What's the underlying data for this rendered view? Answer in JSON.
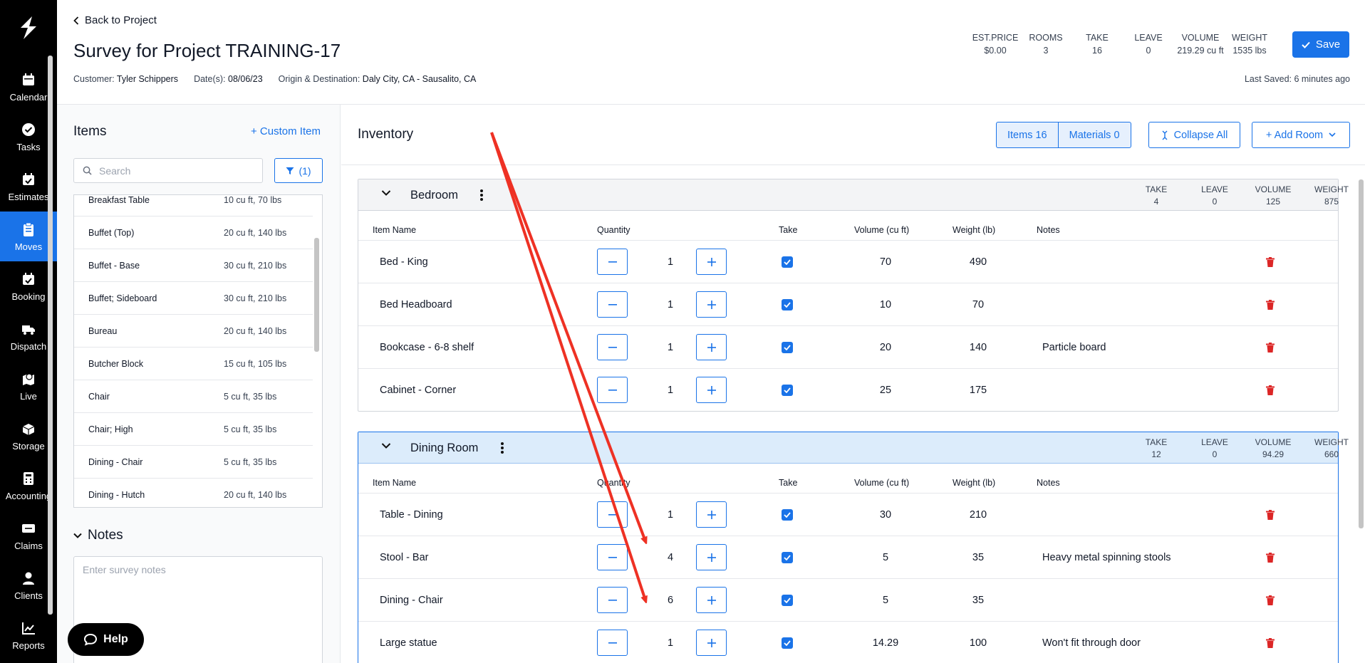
{
  "nav": {
    "items": [
      {
        "label": "Calendar",
        "icon": "calendar-icon"
      },
      {
        "label": "Tasks",
        "icon": "check-circle-icon"
      },
      {
        "label": "Estimates",
        "icon": "calendar-check-icon"
      },
      {
        "label": "Moves",
        "icon": "clipboard-icon",
        "active": true
      },
      {
        "label": "Booking",
        "icon": "calendar-check-icon"
      },
      {
        "label": "Dispatch",
        "icon": "truck-icon"
      },
      {
        "label": "Live",
        "icon": "map-pin-icon"
      },
      {
        "label": "Storage",
        "icon": "box-icon"
      },
      {
        "label": "Accounting",
        "icon": "calculator-icon"
      },
      {
        "label": "Claims",
        "icon": "ticket-icon"
      },
      {
        "label": "Clients",
        "icon": "user-icon"
      },
      {
        "label": "Reports",
        "icon": "chart-icon"
      }
    ]
  },
  "header": {
    "back_label": "Back to Project",
    "title": "Survey for Project TRAINING-17",
    "customer_label": "Customer:",
    "customer": "Tyler Schippers",
    "dates_label": "Date(s):",
    "dates": "08/06/23",
    "route_label": "Origin & Destination:",
    "route": "Daly City, CA - Sausalito, CA",
    "stats": [
      {
        "label": "EST.PRICE",
        "value": "$0.00"
      },
      {
        "label": "ROOMS",
        "value": "3"
      },
      {
        "label": "TAKE",
        "value": "16"
      },
      {
        "label": "LEAVE",
        "value": "0"
      },
      {
        "label": "VOLUME",
        "value": "219.29 cu ft"
      },
      {
        "label": "WEIGHT",
        "value": "1535 lbs"
      }
    ],
    "save_label": "Save",
    "last_saved": "Last Saved: 6 minutes ago"
  },
  "items_panel": {
    "title": "Items",
    "custom_item_label": "+ Custom Item",
    "search_placeholder": "Search",
    "filter_label": "(1)",
    "list": [
      {
        "name": "Breakfast Table",
        "size": "10 cu ft, 70 lbs"
      },
      {
        "name": "Buffet (Top)",
        "size": "20 cu ft, 140 lbs"
      },
      {
        "name": "Buffet - Base",
        "size": "30 cu ft, 210 lbs"
      },
      {
        "name": "Buffet; Sideboard",
        "size": "30 cu ft, 210 lbs"
      },
      {
        "name": "Bureau",
        "size": "20 cu ft, 140 lbs"
      },
      {
        "name": "Butcher Block",
        "size": "15 cu ft, 105 lbs"
      },
      {
        "name": "Chair",
        "size": "5 cu ft, 35 lbs"
      },
      {
        "name": "Chair; High",
        "size": "5 cu ft, 35 lbs"
      },
      {
        "name": "Dining - Chair",
        "size": "5 cu ft, 35 lbs"
      },
      {
        "name": "Dining - Hutch",
        "size": "20 cu ft, 140 lbs"
      }
    ],
    "notes_title": "Notes",
    "notes_placeholder": "Enter survey notes",
    "help_label": "Help"
  },
  "inventory": {
    "title": "Inventory",
    "tab_items": "Items 16",
    "tab_materials": "Materials 0",
    "collapse_label": "Collapse All",
    "add_room_label": "+ Add Room",
    "columns": {
      "item_name": "Item Name",
      "quantity": "Quantity",
      "take": "Take",
      "volume": "Volume (cu ft)",
      "weight": "Weight (lb)",
      "notes": "Notes"
    },
    "stat_labels": {
      "take": "TAKE",
      "leave": "LEAVE",
      "volume": "VOLUME",
      "weight": "WEIGHT"
    },
    "rooms": [
      {
        "name": "Bedroom",
        "take": "4",
        "leave": "0",
        "volume": "125",
        "weight": "875",
        "rows": [
          {
            "name": "Bed - King",
            "qty": "1",
            "volume": "70",
            "weight": "490",
            "notes": ""
          },
          {
            "name": "Bed Headboard",
            "qty": "1",
            "volume": "10",
            "weight": "70",
            "notes": ""
          },
          {
            "name": "Bookcase - 6-8 shelf",
            "qty": "1",
            "volume": "20",
            "weight": "140",
            "notes": "Particle board"
          },
          {
            "name": "Cabinet - Corner",
            "qty": "1",
            "volume": "25",
            "weight": "175",
            "notes": ""
          }
        ]
      },
      {
        "name": "Dining Room",
        "take": "12",
        "leave": "0",
        "volume": "94.29",
        "weight": "660",
        "rows": [
          {
            "name": "Table - Dining",
            "qty": "1",
            "volume": "30",
            "weight": "210",
            "notes": ""
          },
          {
            "name": "Stool - Bar",
            "qty": "4",
            "volume": "5",
            "weight": "35",
            "notes": "Heavy metal spinning stools"
          },
          {
            "name": "Dining - Chair",
            "qty": "6",
            "volume": "5",
            "weight": "35",
            "notes": ""
          },
          {
            "name": "Large statue",
            "qty": "1",
            "volume": "14.29",
            "weight": "100",
            "notes": "Won't fit through door"
          }
        ]
      }
    ]
  },
  "colors": {
    "accent": "#1a73e8",
    "rail": "#000000",
    "danger": "#dc2626",
    "annotation": "#ee3124"
  }
}
